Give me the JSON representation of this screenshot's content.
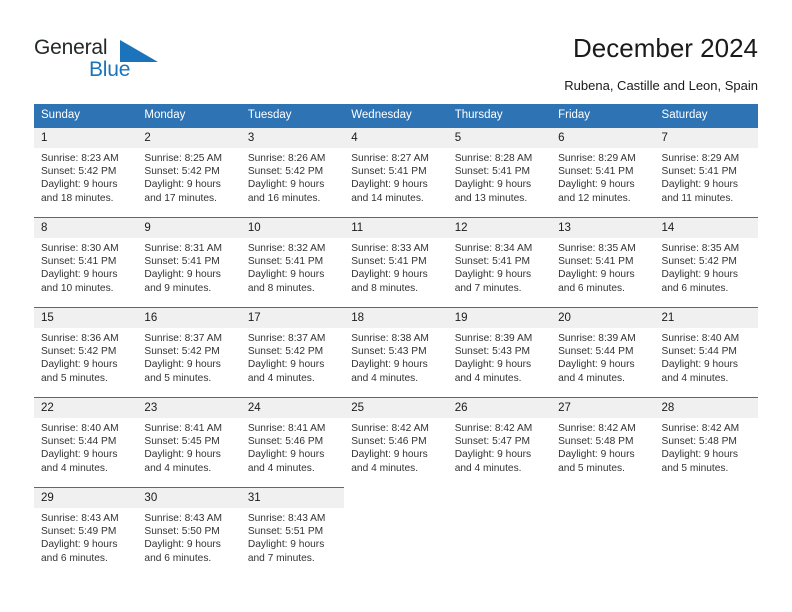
{
  "brand": {
    "name_part1": "General",
    "name_part2": "Blue",
    "triangle_color": "#1b74bb",
    "text_color": "#25282a"
  },
  "header": {
    "title": "December 2024",
    "subtitle": "Rubena, Castille and Leon, Spain"
  },
  "theme": {
    "header_bar_color": "#2e74b5",
    "daynum_band_color": "#f0f0f0",
    "row_border_color": "#2e74b5",
    "page_background": "#ffffff"
  },
  "weekday_headers": [
    "Sunday",
    "Monday",
    "Tuesday",
    "Wednesday",
    "Thursday",
    "Friday",
    "Saturday"
  ],
  "weeks": [
    [
      {
        "day": "1",
        "sunrise": "Sunrise: 8:23 AM",
        "sunset": "Sunset: 5:42 PM",
        "daylight_line1": "Daylight: 9 hours",
        "daylight_line2": "and 18 minutes."
      },
      {
        "day": "2",
        "sunrise": "Sunrise: 8:25 AM",
        "sunset": "Sunset: 5:42 PM",
        "daylight_line1": "Daylight: 9 hours",
        "daylight_line2": "and 17 minutes."
      },
      {
        "day": "3",
        "sunrise": "Sunrise: 8:26 AM",
        "sunset": "Sunset: 5:42 PM",
        "daylight_line1": "Daylight: 9 hours",
        "daylight_line2": "and 16 minutes."
      },
      {
        "day": "4",
        "sunrise": "Sunrise: 8:27 AM",
        "sunset": "Sunset: 5:41 PM",
        "daylight_line1": "Daylight: 9 hours",
        "daylight_line2": "and 14 minutes."
      },
      {
        "day": "5",
        "sunrise": "Sunrise: 8:28 AM",
        "sunset": "Sunset: 5:41 PM",
        "daylight_line1": "Daylight: 9 hours",
        "daylight_line2": "and 13 minutes."
      },
      {
        "day": "6",
        "sunrise": "Sunrise: 8:29 AM",
        "sunset": "Sunset: 5:41 PM",
        "daylight_line1": "Daylight: 9 hours",
        "daylight_line2": "and 12 minutes."
      },
      {
        "day": "7",
        "sunrise": "Sunrise: 8:29 AM",
        "sunset": "Sunset: 5:41 PM",
        "daylight_line1": "Daylight: 9 hours",
        "daylight_line2": "and 11 minutes."
      }
    ],
    [
      {
        "day": "8",
        "sunrise": "Sunrise: 8:30 AM",
        "sunset": "Sunset: 5:41 PM",
        "daylight_line1": "Daylight: 9 hours",
        "daylight_line2": "and 10 minutes."
      },
      {
        "day": "9",
        "sunrise": "Sunrise: 8:31 AM",
        "sunset": "Sunset: 5:41 PM",
        "daylight_line1": "Daylight: 9 hours",
        "daylight_line2": "and 9 minutes."
      },
      {
        "day": "10",
        "sunrise": "Sunrise: 8:32 AM",
        "sunset": "Sunset: 5:41 PM",
        "daylight_line1": "Daylight: 9 hours",
        "daylight_line2": "and 8 minutes."
      },
      {
        "day": "11",
        "sunrise": "Sunrise: 8:33 AM",
        "sunset": "Sunset: 5:41 PM",
        "daylight_line1": "Daylight: 9 hours",
        "daylight_line2": "and 8 minutes."
      },
      {
        "day": "12",
        "sunrise": "Sunrise: 8:34 AM",
        "sunset": "Sunset: 5:41 PM",
        "daylight_line1": "Daylight: 9 hours",
        "daylight_line2": "and 7 minutes."
      },
      {
        "day": "13",
        "sunrise": "Sunrise: 8:35 AM",
        "sunset": "Sunset: 5:41 PM",
        "daylight_line1": "Daylight: 9 hours",
        "daylight_line2": "and 6 minutes."
      },
      {
        "day": "14",
        "sunrise": "Sunrise: 8:35 AM",
        "sunset": "Sunset: 5:42 PM",
        "daylight_line1": "Daylight: 9 hours",
        "daylight_line2": "and 6 minutes."
      }
    ],
    [
      {
        "day": "15",
        "sunrise": "Sunrise: 8:36 AM",
        "sunset": "Sunset: 5:42 PM",
        "daylight_line1": "Daylight: 9 hours",
        "daylight_line2": "and 5 minutes."
      },
      {
        "day": "16",
        "sunrise": "Sunrise: 8:37 AM",
        "sunset": "Sunset: 5:42 PM",
        "daylight_line1": "Daylight: 9 hours",
        "daylight_line2": "and 5 minutes."
      },
      {
        "day": "17",
        "sunrise": "Sunrise: 8:37 AM",
        "sunset": "Sunset: 5:42 PM",
        "daylight_line1": "Daylight: 9 hours",
        "daylight_line2": "and 4 minutes."
      },
      {
        "day": "18",
        "sunrise": "Sunrise: 8:38 AM",
        "sunset": "Sunset: 5:43 PM",
        "daylight_line1": "Daylight: 9 hours",
        "daylight_line2": "and 4 minutes."
      },
      {
        "day": "19",
        "sunrise": "Sunrise: 8:39 AM",
        "sunset": "Sunset: 5:43 PM",
        "daylight_line1": "Daylight: 9 hours",
        "daylight_line2": "and 4 minutes."
      },
      {
        "day": "20",
        "sunrise": "Sunrise: 8:39 AM",
        "sunset": "Sunset: 5:44 PM",
        "daylight_line1": "Daylight: 9 hours",
        "daylight_line2": "and 4 minutes."
      },
      {
        "day": "21",
        "sunrise": "Sunrise: 8:40 AM",
        "sunset": "Sunset: 5:44 PM",
        "daylight_line1": "Daylight: 9 hours",
        "daylight_line2": "and 4 minutes."
      }
    ],
    [
      {
        "day": "22",
        "sunrise": "Sunrise: 8:40 AM",
        "sunset": "Sunset: 5:44 PM",
        "daylight_line1": "Daylight: 9 hours",
        "daylight_line2": "and 4 minutes."
      },
      {
        "day": "23",
        "sunrise": "Sunrise: 8:41 AM",
        "sunset": "Sunset: 5:45 PM",
        "daylight_line1": "Daylight: 9 hours",
        "daylight_line2": "and 4 minutes."
      },
      {
        "day": "24",
        "sunrise": "Sunrise: 8:41 AM",
        "sunset": "Sunset: 5:46 PM",
        "daylight_line1": "Daylight: 9 hours",
        "daylight_line2": "and 4 minutes."
      },
      {
        "day": "25",
        "sunrise": "Sunrise: 8:42 AM",
        "sunset": "Sunset: 5:46 PM",
        "daylight_line1": "Daylight: 9 hours",
        "daylight_line2": "and 4 minutes."
      },
      {
        "day": "26",
        "sunrise": "Sunrise: 8:42 AM",
        "sunset": "Sunset: 5:47 PM",
        "daylight_line1": "Daylight: 9 hours",
        "daylight_line2": "and 4 minutes."
      },
      {
        "day": "27",
        "sunrise": "Sunrise: 8:42 AM",
        "sunset": "Sunset: 5:48 PM",
        "daylight_line1": "Daylight: 9 hours",
        "daylight_line2": "and 5 minutes."
      },
      {
        "day": "28",
        "sunrise": "Sunrise: 8:42 AM",
        "sunset": "Sunset: 5:48 PM",
        "daylight_line1": "Daylight: 9 hours",
        "daylight_line2": "and 5 minutes."
      }
    ],
    [
      {
        "day": "29",
        "sunrise": "Sunrise: 8:43 AM",
        "sunset": "Sunset: 5:49 PM",
        "daylight_line1": "Daylight: 9 hours",
        "daylight_line2": "and 6 minutes."
      },
      {
        "day": "30",
        "sunrise": "Sunrise: 8:43 AM",
        "sunset": "Sunset: 5:50 PM",
        "daylight_line1": "Daylight: 9 hours",
        "daylight_line2": "and 6 minutes."
      },
      {
        "day": "31",
        "sunrise": "Sunrise: 8:43 AM",
        "sunset": "Sunset: 5:51 PM",
        "daylight_line1": "Daylight: 9 hours",
        "daylight_line2": "and 7 minutes."
      },
      {
        "day": "",
        "sunrise": "",
        "sunset": "",
        "daylight_line1": "",
        "daylight_line2": "",
        "empty": true
      },
      {
        "day": "",
        "sunrise": "",
        "sunset": "",
        "daylight_line1": "",
        "daylight_line2": "",
        "empty": true
      },
      {
        "day": "",
        "sunrise": "",
        "sunset": "",
        "daylight_line1": "",
        "daylight_line2": "",
        "empty": true
      },
      {
        "day": "",
        "sunrise": "",
        "sunset": "",
        "daylight_line1": "",
        "daylight_line2": "",
        "empty": true
      }
    ]
  ]
}
